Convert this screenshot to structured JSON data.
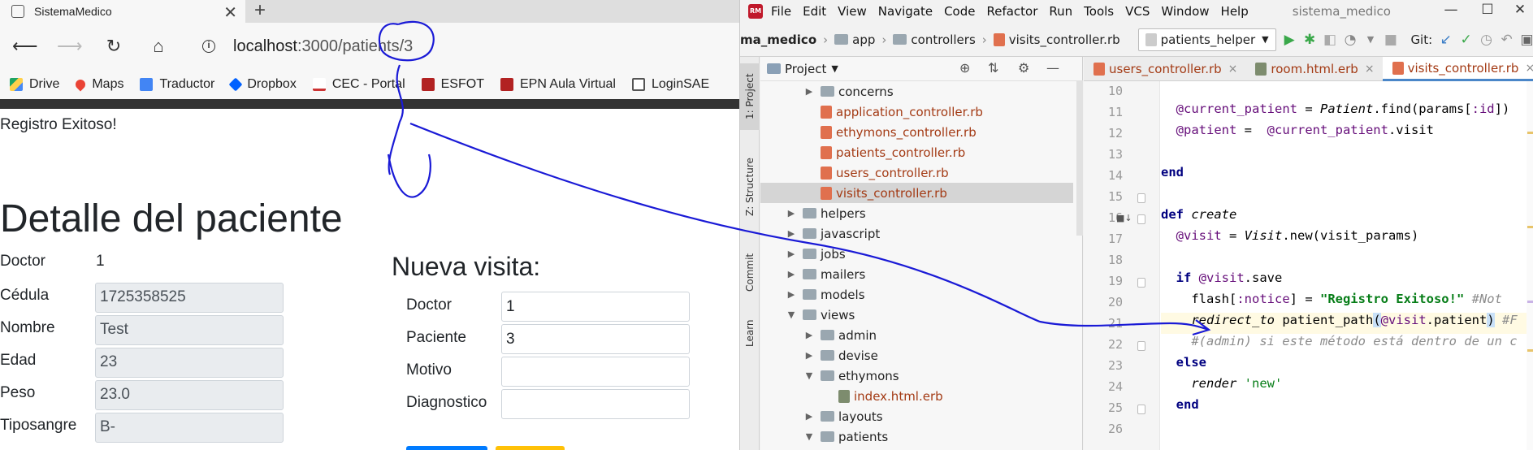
{
  "browser": {
    "tab_title": "SistemaMedico",
    "url_host": "localhost",
    "url_path": ":3000/patients/3",
    "bookmarks": [
      "Drive",
      "Maps",
      "Traductor",
      "Dropbox",
      "CEC - Portal",
      "ESFOT",
      "EPN Aula Virtual",
      "LoginSAE"
    ]
  },
  "page": {
    "notice": "Registro Exitoso!",
    "title": "Detalle del paciente",
    "doctor_label": "Doctor",
    "doctor_value": "1",
    "cedula_label": "Cédula",
    "cedula_value": "1725358525",
    "nombre_label": "Nombre",
    "nombre_value": "Test",
    "edad_label": "Edad",
    "edad_value": "23",
    "peso_label": "Peso",
    "peso_value": "23.0",
    "tiposangre_label": "Tiposangre",
    "tiposangre_value": "B-",
    "visit_form": {
      "title": "Nueva visita:",
      "doctor_label": "Doctor",
      "doctor_value": "1",
      "paciente_label": "Paciente",
      "paciente_value": "3",
      "motivo_label": "Motivo",
      "motivo_value": "",
      "diagnostico_label": "Diagnostico",
      "diagnostico_value": ""
    }
  },
  "ide": {
    "menu": [
      "File",
      "Edit",
      "View",
      "Navigate",
      "Code",
      "Refactor",
      "Run",
      "Tools",
      "VCS",
      "Window",
      "Help"
    ],
    "project_title": "sistema_medico",
    "breadcrumb": [
      "ma_medico",
      "app",
      "controllers",
      "visits_controller.rb"
    ],
    "run_config": "patients_helper",
    "git_label": "Git:",
    "side_tabs": [
      "1: Project",
      "Z: Structure",
      "Commit",
      "Learn"
    ],
    "project_panel_title": "Project",
    "tree": [
      {
        "label": "concerns",
        "type": "folder",
        "depth": 2,
        "arrow": "right"
      },
      {
        "label": "application_controller.rb",
        "type": "ruby",
        "depth": 2,
        "arrow": ""
      },
      {
        "label": "ethymons_controller.rb",
        "type": "ruby",
        "depth": 2,
        "arrow": ""
      },
      {
        "label": "patients_controller.rb",
        "type": "ruby",
        "depth": 2,
        "arrow": ""
      },
      {
        "label": "users_controller.rb",
        "type": "ruby",
        "depth": 2,
        "arrow": ""
      },
      {
        "label": "visits_controller.rb",
        "type": "ruby",
        "depth": 2,
        "arrow": "",
        "selected": true
      },
      {
        "label": "helpers",
        "type": "folder",
        "depth": 1,
        "arrow": "right"
      },
      {
        "label": "javascript",
        "type": "folder",
        "depth": 1,
        "arrow": "right"
      },
      {
        "label": "jobs",
        "type": "folder",
        "depth": 1,
        "arrow": "right"
      },
      {
        "label": "mailers",
        "type": "folder",
        "depth": 1,
        "arrow": "right"
      },
      {
        "label": "models",
        "type": "folder",
        "depth": 1,
        "arrow": "right"
      },
      {
        "label": "views",
        "type": "folder",
        "depth": 1,
        "arrow": "down"
      },
      {
        "label": "admin",
        "type": "folder",
        "depth": 2,
        "arrow": "right"
      },
      {
        "label": "devise",
        "type": "folder",
        "depth": 2,
        "arrow": "right"
      },
      {
        "label": "ethymons",
        "type": "folder",
        "depth": 2,
        "arrow": "down"
      },
      {
        "label": "index.html.erb",
        "type": "erb",
        "depth": 3,
        "arrow": ""
      },
      {
        "label": "layouts",
        "type": "folder",
        "depth": 2,
        "arrow": "right"
      },
      {
        "label": "patients",
        "type": "folder",
        "depth": 2,
        "arrow": "down"
      }
    ],
    "editor_tabs": [
      {
        "label": "users_controller.rb",
        "active": false
      },
      {
        "label": "room.html.erb",
        "active": false
      },
      {
        "label": "visits_controller.rb",
        "active": true
      }
    ],
    "line_numbers": [
      "10",
      "11",
      "12",
      "13",
      "14",
      "15",
      "16",
      "17",
      "18",
      "19",
      "20",
      "21",
      "22",
      "23",
      "24",
      "25",
      "26"
    ],
    "code": {
      "l11_a": "@current_patient",
      "l11_b": " = ",
      "l11_c": "Patient",
      "l11_d": ".find(params[",
      "l11_e": ":id",
      "l11_f": "])",
      "l12_a": "@patient",
      "l12_b": " =  ",
      "l12_c": "@current_patient",
      "l12_d": ".visit",
      "l14": "end",
      "l16_a": "def ",
      "l16_b": "create",
      "l17_a": "@visit",
      "l17_b": " = ",
      "l17_c": "Visit",
      "l17_d": ".new(visit_params)",
      "l19_a": "if ",
      "l19_b": "@visit",
      "l19_c": ".save",
      "l20_a": "flash[",
      "l20_b": ":notice",
      "l20_c": "] = ",
      "l20_d": "\"Registro Exitoso!\"",
      "l20_e": " #Not",
      "l21_a": "redirect_to",
      "l21_b": " patient_path",
      "l21_c": "(",
      "l21_d": "@visit",
      "l21_e": ".patient",
      "l21_f": ")",
      "l21_g": " #F",
      "l22": "#(admin) si este método está dentro de un c",
      "l23": "else",
      "l24_a": "render",
      "l24_b": " 'new'",
      "l25": "end"
    }
  }
}
